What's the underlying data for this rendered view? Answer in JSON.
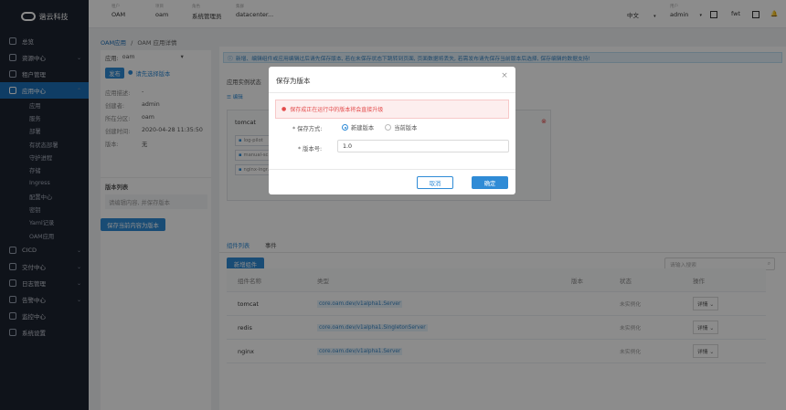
{
  "sidebar": {
    "logo_text": "谐云科技",
    "items": [
      {
        "label": "总览",
        "icon": "dashboard-icon",
        "arrow": ""
      },
      {
        "label": "资源中心",
        "icon": "cube-icon",
        "arrow": "⌄"
      },
      {
        "label": "租户管理",
        "icon": "users-icon",
        "arrow": ""
      },
      {
        "label": "应用中心",
        "icon": "app-icon",
        "arrow": "⌃"
      }
    ],
    "sub_items": [
      "应用",
      "服务",
      "部署",
      "有状态部署",
      "守护进程",
      "存储",
      "Ingress",
      "配置中心",
      "密钥",
      "Yaml记录",
      "OAM应用"
    ],
    "items2": [
      {
        "label": "CICD",
        "icon": "cicd-icon",
        "arrow": "⌄"
      },
      {
        "label": "交付中心",
        "icon": "delivery-icon",
        "arrow": "⌄"
      },
      {
        "label": "日志管理",
        "icon": "log-icon",
        "arrow": "⌄"
      },
      {
        "label": "告警中心",
        "icon": "bell-icon",
        "arrow": "⌄"
      },
      {
        "label": "监控中心",
        "icon": "monitor-icon",
        "arrow": ""
      },
      {
        "label": "系统设置",
        "icon": "settings-icon",
        "arrow": ""
      }
    ]
  },
  "topbar": {
    "crumbs": [
      {
        "small": "租户",
        "value": "OAM"
      },
      {
        "small": "项目",
        "value": "oam"
      },
      {
        "small": "角色",
        "value": "系统管理员"
      },
      {
        "small": "集群",
        "value": "datacenter..."
      }
    ],
    "lang": "中文",
    "user_small": "用户",
    "user": "admin",
    "icons": [
      "logout-icon",
      "help-icon",
      "doc-icon",
      "bell-icon"
    ],
    "icon_text": "fwt"
  },
  "breadcrumb": {
    "parent": "OAM应用",
    "sep": "/",
    "current": "OAM 应用详情"
  },
  "left_panel": {
    "app_label": "应用:",
    "app_value": "oam",
    "publish": "发布",
    "choose_version": "请先选择版本",
    "info": [
      {
        "k": "应用描述:",
        "v": "-"
      },
      {
        "k": "创建者:",
        "v": "admin"
      },
      {
        "k": "所在分区:",
        "v": "oam"
      },
      {
        "k": "创建时间:",
        "v": "2020-04-28 11:35:50"
      },
      {
        "k": "版本:",
        "v": "无"
      }
    ],
    "version_list_title": "版本列表",
    "version_hint": "请编辑内容, 并保存版本",
    "save_button": "保存当前内容为版本"
  },
  "right_panel": {
    "notice": "新增、编辑组件或应用编辑过后请先保存版本, 若在未保存状态下跳转到页面, 页面数据将丢失, 若需发布请先保存当前版本后选择, 保存编辑的数据支持!",
    "instance_label": "应用实例状态",
    "edit_label": "编辑",
    "instance_name": "tomcat",
    "traits": [
      "log-pilot",
      "manual-sc...",
      "nginx-ingr..."
    ],
    "tabs": [
      "组件列表",
      "事件"
    ],
    "add_button": "新增组件",
    "search_placeholder": "请输入搜索",
    "columns": [
      "组件名称",
      "类型",
      "版本",
      "状态",
      "操作"
    ],
    "rows": [
      {
        "name": "tomcat",
        "type": "core.oam.dev/v1alpha1.Server",
        "version": "",
        "status": "未实例化",
        "op": "详情"
      },
      {
        "name": "redis",
        "type": "core.oam.dev/v1alpha1.SingletonServer",
        "version": "",
        "status": "未实例化",
        "op": "详情"
      },
      {
        "name": "nginx",
        "type": "core.oam.dev/v1alpha1.Server",
        "version": "",
        "status": "未实例化",
        "op": "详情"
      }
    ]
  },
  "modal": {
    "title": "保存为版本",
    "close": "×",
    "warning": "保存成正在运行中的版本将会直接升级",
    "method_label": "* 保存方式:",
    "options": [
      "新建版本",
      "当前版本"
    ],
    "selected_option": "新建版本",
    "version_label": "* 版本号:",
    "version_value": "1.0",
    "cancel": "取消",
    "ok": "确定"
  },
  "colors": {
    "accent": "#2f8bd6",
    "sidebar": "#1d2330",
    "warning": "#e34b4b"
  }
}
